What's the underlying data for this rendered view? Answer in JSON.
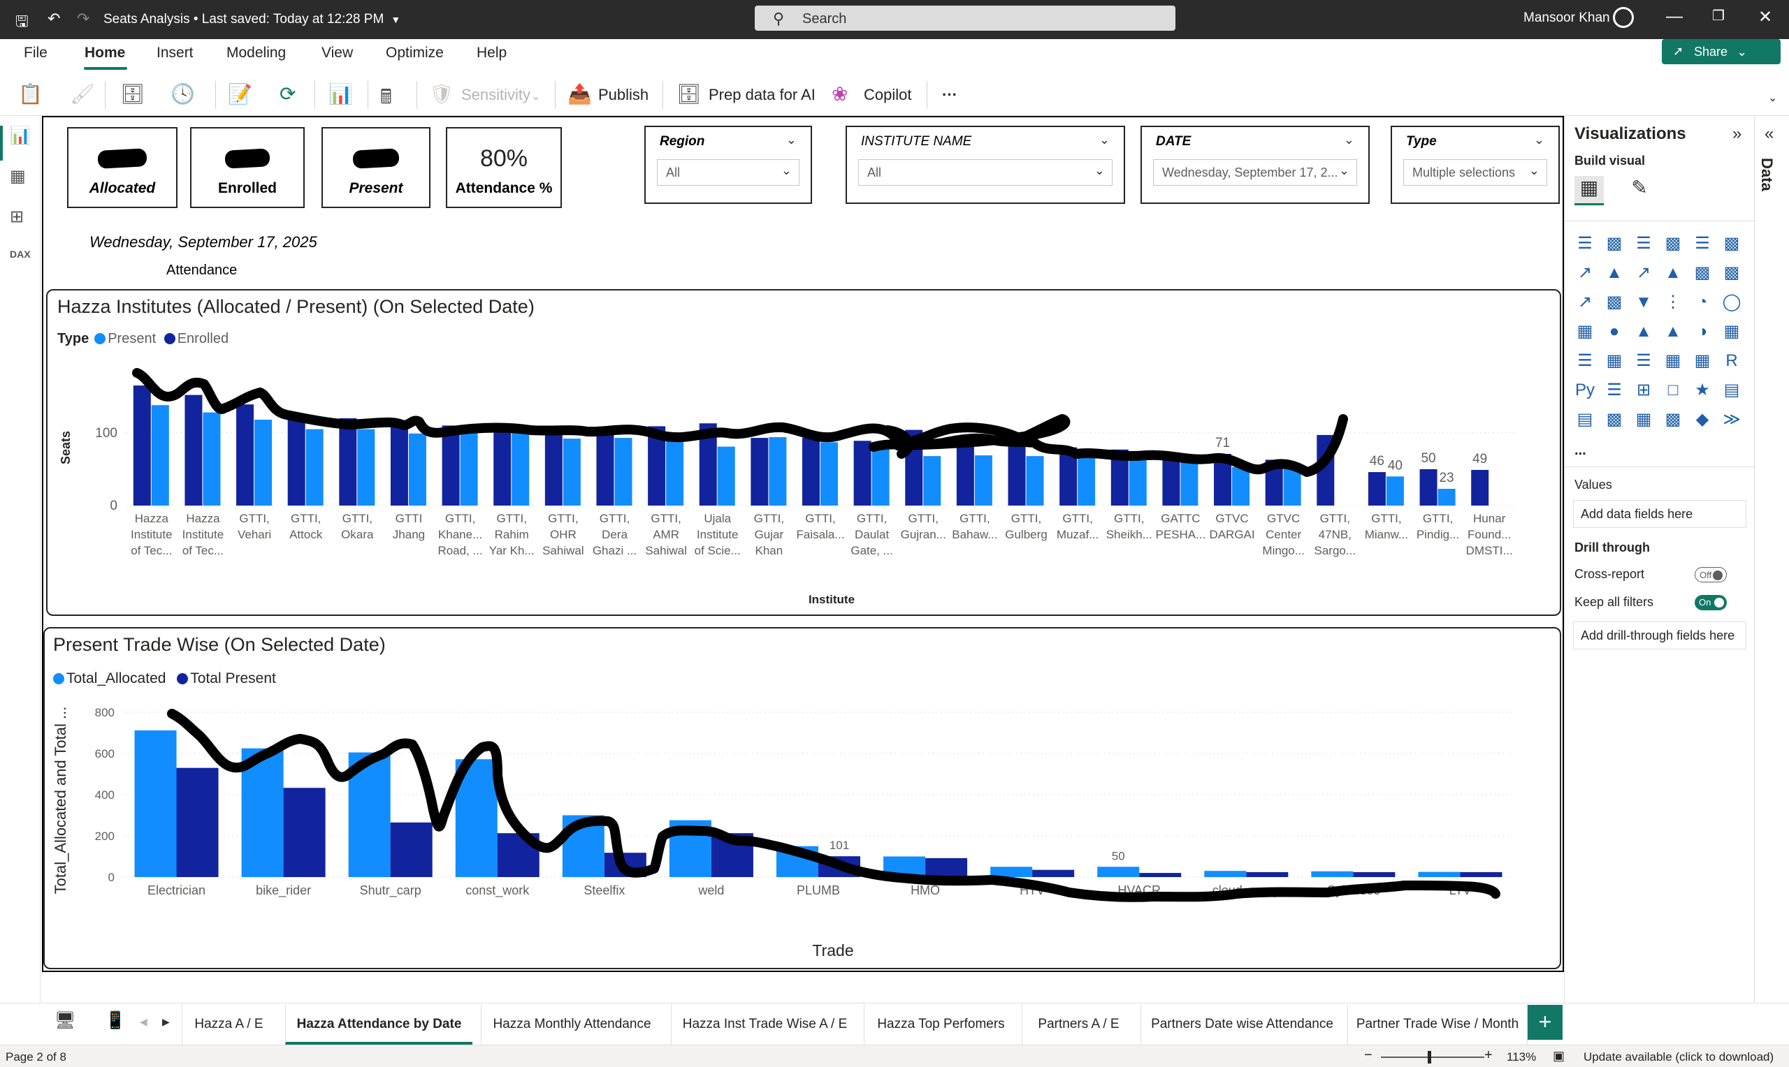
{
  "window": {
    "title": "Seats Analysis • Last saved: Today at 12:28 PM",
    "search_placeholder": "Search",
    "user": "Mansoor Khan"
  },
  "menu": {
    "items": [
      "File",
      "Home",
      "Insert",
      "Modeling",
      "View",
      "Optimize",
      "Help"
    ],
    "active": "Home",
    "share": "Share"
  },
  "toolbar": {
    "sensitivity": "Sensitivity",
    "publish": "Publish",
    "prep_data": "Prep data for AI",
    "copilot": "Copilot"
  },
  "cards": [
    {
      "value": "",
      "label": "Allocated",
      "redacted": true
    },
    {
      "value": "",
      "label": "Enrolled",
      "redacted": true
    },
    {
      "value": "",
      "label": "Present",
      "redacted": true
    },
    {
      "value": "80%",
      "label": "Attendance %",
      "redacted": false
    }
  ],
  "selected_date_label": "Wednesday, September 17, 2025",
  "attendance_label": "Attendance",
  "slicers": [
    {
      "title": "Region",
      "value": "All"
    },
    {
      "title": "INSTITUTE NAME",
      "value": "All"
    },
    {
      "title": "DATE",
      "value": "Wednesday, September 17, 2..."
    },
    {
      "title": "Type",
      "value": "Multiple selections"
    }
  ],
  "chart_data": [
    {
      "type": "bar",
      "title": "Hazza Institutes (Allocated / Present) (On Selected Date)",
      "legend_title": "Type",
      "xlabel": "Institute",
      "ylabel": "Seats",
      "ylim": [
        0,
        190
      ],
      "yticks": [
        0,
        100
      ],
      "grid": true,
      "categories": [
        [
          "Hazza",
          "Institute",
          "of Tec..."
        ],
        [
          "Hazza",
          "Institute",
          "of Tec..."
        ],
        [
          "GTTI,",
          "Vehari"
        ],
        [
          "GTTI,",
          "Attock"
        ],
        [
          "GTTI,",
          "Okara"
        ],
        [
          "GTTI",
          "Jhang"
        ],
        [
          "GTTI,",
          "Khane...",
          "Road, ..."
        ],
        [
          "GTTI,",
          "Rahim",
          "Yar Kh..."
        ],
        [
          "GTTI,",
          "OHR",
          "Sahiwal"
        ],
        [
          "GTTI,",
          "Dera",
          "Ghazi ..."
        ],
        [
          "GTTI,",
          "AMR",
          "Sahiwal"
        ],
        [
          "Ujala",
          "Institute",
          "of Scie..."
        ],
        [
          "GTTI,",
          "Gujar",
          "Khan"
        ],
        [
          "GTTI,",
          "Faisala..."
        ],
        [
          "GTTI,",
          "Daulat",
          "Gate, ..."
        ],
        [
          "GTTI,",
          "Gujran..."
        ],
        [
          "GTTI,",
          "Bahaw..."
        ],
        [
          "GTTI,",
          "Gulberg"
        ],
        [
          "GTTI,",
          "Muzaf..."
        ],
        [
          "GTTI,",
          "Sheikh..."
        ],
        [
          "GATTC",
          "PESHA..."
        ],
        [
          "GTVC",
          "DARGAI"
        ],
        [
          "GTVC",
          "Center",
          "Mingo..."
        ],
        [
          "GTTI,",
          "47NB,",
          "Sargo..."
        ],
        [
          "GTTI,",
          "Mianw..."
        ],
        [
          "GTTI,",
          "Pindig..."
        ],
        [
          "Hunar",
          "Found...",
          "DMSTI..."
        ]
      ],
      "series": [
        {
          "name": "Enrolled",
          "color": "#12239e",
          "values": [
            165,
            152,
            139,
            124,
            120,
            116,
            110,
            109,
            108,
            106,
            109,
            113,
            93,
            93,
            89,
            104,
            95,
            84,
            80,
            77,
            73,
            71,
            63,
            97,
            46,
            50,
            49
          ]
        },
        {
          "name": "Present",
          "color": "#118dff",
          "values": [
            138,
            128,
            118,
            105,
            105,
            99,
            106,
            101,
            92,
            93,
            91,
            81,
            94,
            87,
            79,
            68,
            69,
            68,
            72,
            68,
            63,
            53,
            57,
            0,
            40,
            23,
            0
          ]
        }
      ],
      "data_labels": [
        {
          "category_index": 21,
          "series": "Enrolled",
          "text": "71"
        },
        {
          "category_index": 24,
          "series": "Enrolled",
          "text": "46"
        },
        {
          "category_index": 24,
          "series": "Present",
          "text": "40"
        },
        {
          "category_index": 25,
          "series": "Enrolled",
          "text": "50"
        },
        {
          "category_index": 25,
          "series": "Present",
          "text": "23"
        },
        {
          "category_index": 26,
          "series": "Enrolled",
          "text": "49"
        }
      ]
    },
    {
      "type": "bar",
      "title": "Present Trade Wise (On Selected Date)",
      "xlabel": "Trade",
      "ylabel": "Total_Allocated and Total ...",
      "ylim": [
        0,
        800
      ],
      "yticks": [
        0,
        200,
        400,
        600,
        800
      ],
      "grid": true,
      "categories": [
        "Electrician",
        "bike_rider",
        "Shutr_carp",
        "const_work",
        "Steelfix",
        "weld",
        "PLUMB",
        "HMO",
        "HTV",
        "HVACR",
        "cloud_comp",
        "Cybersec",
        "LTV"
      ],
      "series": [
        {
          "name": "Total_Allocated",
          "color": "#118dff",
          "values": [
            712,
            625,
            605,
            572,
            300,
            276,
            150,
            100,
            50,
            50,
            30,
            28,
            25
          ]
        },
        {
          "name": "Total Present",
          "color": "#12239e",
          "values": [
            530,
            433,
            265,
            213,
            118,
            213,
            101,
            92,
            35,
            20,
            24,
            24,
            24
          ]
        }
      ],
      "data_labels": [
        {
          "category_index": 6,
          "series": "Total Present",
          "text": "101"
        },
        {
          "category_index": 9,
          "series": "Total_Allocated",
          "text": "50"
        }
      ]
    }
  ],
  "viz_pane": {
    "title": "Visualizations",
    "build_visual": "Build visual",
    "values_label": "Values",
    "values_placeholder": "Add data fields here",
    "drill_through": "Drill through",
    "cross_report": "Cross-report",
    "cross_report_state": "Off",
    "keep_all_filters": "Keep all filters",
    "keep_all_filters_state": "On",
    "drill_placeholder": "Add drill-through fields here",
    "more": "..."
  },
  "data_pane_label": "Data",
  "pages": [
    "Hazza A / E",
    "Hazza Attendance by Date",
    "Hazza Monthly Attendance",
    "Hazza Inst Trade Wise A / E",
    "Hazza Top Perfomers",
    "Partners A / E",
    "Partners Date wise Attendance",
    "Partner Trade Wise / Month"
  ],
  "active_page": "Hazza Attendance by Date",
  "status": {
    "page": "Page 2 of 8",
    "zoom": "113%",
    "update": "Update available (click to download)"
  }
}
